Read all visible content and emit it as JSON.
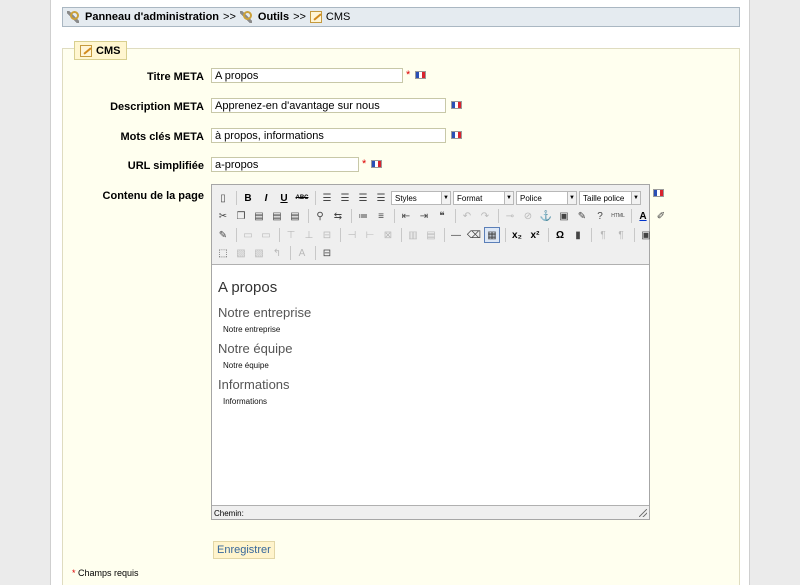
{
  "breadcrumb": {
    "admin_label": "Panneau d'administration",
    "separator": ">>",
    "tools_label": "Outils",
    "current_label": "CMS"
  },
  "section": {
    "legend": "CMS"
  },
  "form": {
    "title_label": "Titre META",
    "title_value": "A propos",
    "description_label": "Description META",
    "description_value": "Apprenez-en d'avantage sur nous",
    "keywords_label": "Mots clés META",
    "keywords_value": "à propos, informations",
    "url_label": "URL simplifiée",
    "url_value": "a-propos",
    "content_label": "Contenu de la page",
    "required_mark": "*"
  },
  "toolbar": {
    "styles_label": "Styles",
    "format_label": "Format",
    "font_label": "Police",
    "size_label": "Taille police",
    "bold": "B",
    "italic": "I",
    "underline": "U",
    "strike": "ABC",
    "subscript": "x₂",
    "superscript": "x²",
    "omega": "Ω",
    "text_color": "A"
  },
  "editor_content": {
    "heading": "A propos",
    "section1_title": "Notre entreprise",
    "section1_text": "Notre entreprise",
    "section2_title": "Notre équipe",
    "section2_text": "Notre équipe",
    "section3_title": "Informations",
    "section3_text": "Informations"
  },
  "editor_status": "Chemin:",
  "save_button": "Enregistrer",
  "required_note": "Champs requis",
  "flag_colors": {
    "blue": "#2a4fb5",
    "white": "#ffffff",
    "red": "#d9232e"
  }
}
